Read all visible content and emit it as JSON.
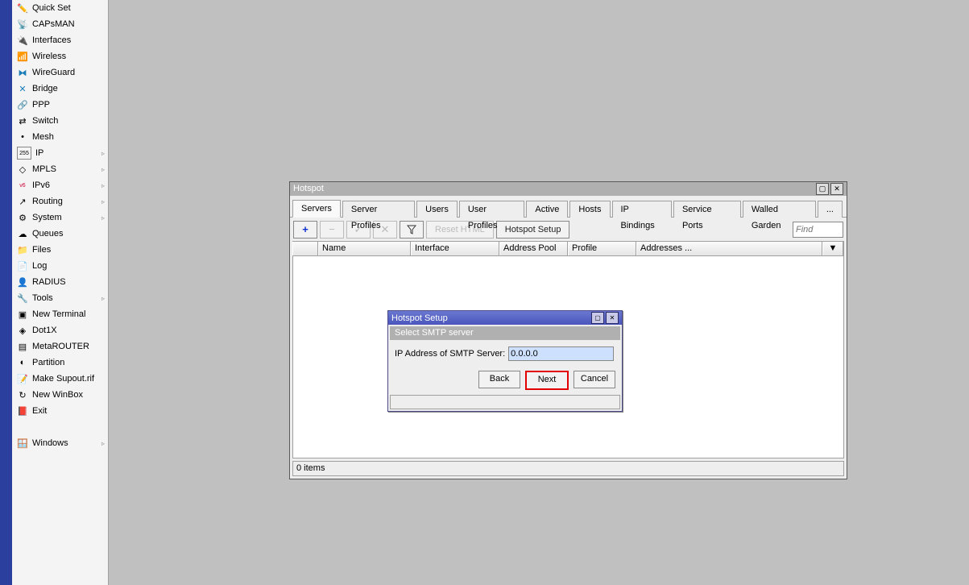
{
  "sidebar": {
    "items": [
      {
        "label": "Quick Set",
        "icon": "✏️"
      },
      {
        "label": "CAPsMAN",
        "icon": "📡"
      },
      {
        "label": "Interfaces",
        "icon": "🔌"
      },
      {
        "label": "Wireless",
        "icon": "📶"
      },
      {
        "label": "WireGuard",
        "icon": "🔷"
      },
      {
        "label": "Bridge",
        "icon": "🌉"
      },
      {
        "label": "PPP",
        "icon": "🔗"
      },
      {
        "label": "Switch",
        "icon": "🔀"
      },
      {
        "label": "Mesh",
        "icon": "•"
      },
      {
        "label": "IP",
        "icon": "255",
        "submenu": true
      },
      {
        "label": "MPLS",
        "icon": "◇",
        "submenu": true
      },
      {
        "label": "IPv6",
        "icon": "v6",
        "submenu": true
      },
      {
        "label": "Routing",
        "icon": "↗",
        "submenu": true
      },
      {
        "label": "System",
        "icon": "⚙",
        "submenu": true
      },
      {
        "label": "Queues",
        "icon": "☁"
      },
      {
        "label": "Files",
        "icon": "📁"
      },
      {
        "label": "Log",
        "icon": "📄"
      },
      {
        "label": "RADIUS",
        "icon": "👤"
      },
      {
        "label": "Tools",
        "icon": "🔧",
        "submenu": true
      },
      {
        "label": "New Terminal",
        "icon": "▣"
      },
      {
        "label": "Dot1X",
        "icon": "◈"
      },
      {
        "label": "MetaROUTER",
        "icon": "▤"
      },
      {
        "label": "Partition",
        "icon": "◐"
      },
      {
        "label": "Make Supout.rif",
        "icon": "📝"
      },
      {
        "label": "New WinBox",
        "icon": "↻"
      },
      {
        "label": "Exit",
        "icon": "📕"
      }
    ],
    "windows_label": "Windows",
    "windows_icon": "🪟"
  },
  "hotspot_window": {
    "title": "Hotspot",
    "tabs": [
      "Servers",
      "Server Profiles",
      "Users",
      "User Profiles",
      "Active",
      "Hosts",
      "IP Bindings",
      "Service Ports",
      "Walled Garden",
      "..."
    ],
    "active_tab": 0,
    "toolbar": {
      "reset": "Reset HTML",
      "setup": "Hotspot Setup",
      "find_placeholder": "Find"
    },
    "columns": [
      "Name",
      "Interface",
      "Address Pool",
      "Profile",
      "Addresses ..."
    ],
    "status": "0 items"
  },
  "setup_dialog": {
    "title": "Hotspot Setup",
    "subtitle": "Select SMTP server",
    "field_label": "IP Address of SMTP Server:",
    "field_value": "0.0.0.0",
    "buttons": {
      "back": "Back",
      "next": "Next",
      "cancel": "Cancel"
    }
  }
}
